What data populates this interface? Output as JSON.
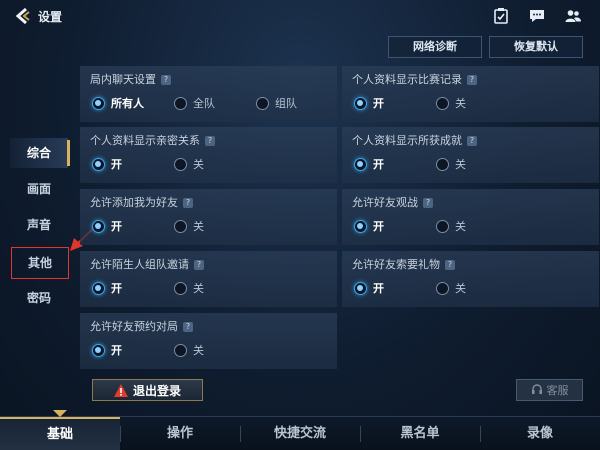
{
  "header": {
    "title": "设置",
    "buttons": {
      "network": "网络诊断",
      "restore": "恢复默认"
    }
  },
  "sidebar": {
    "items": [
      {
        "label": "综合",
        "active": true
      },
      {
        "label": "画面"
      },
      {
        "label": "声音"
      },
      {
        "label": "其他",
        "highlighted": true
      },
      {
        "label": "密码"
      }
    ]
  },
  "panels": {
    "chat": {
      "title": "局内聊天设置",
      "options": [
        "所有人",
        "全队",
        "组队"
      ],
      "selected": "所有人"
    },
    "stats": {
      "title": "个人资料显示比赛记录",
      "options": [
        "开",
        "关"
      ],
      "selected": "开"
    },
    "intimacy": {
      "title": "个人资料显示亲密关系",
      "options": [
        "开",
        "关"
      ],
      "selected": "开"
    },
    "achievements": {
      "title": "个人资料显示所获成就",
      "options": [
        "开",
        "关"
      ],
      "selected": "开"
    },
    "addfriend": {
      "title": "允许添加我为好友",
      "options": [
        "开",
        "关"
      ],
      "selected": "开"
    },
    "spectate": {
      "title": "允许好友观战",
      "options": [
        "开",
        "关"
      ],
      "selected": "开"
    },
    "stranger": {
      "title": "允许陌生人组队邀请",
      "options": [
        "开",
        "关"
      ],
      "selected": "开"
    },
    "gifts": {
      "title": "允许好友索要礼物",
      "options": [
        "开",
        "关"
      ],
      "selected": "开"
    },
    "booking": {
      "title": "允许好友预约对局",
      "options": [
        "开",
        "关"
      ],
      "selected": "开"
    }
  },
  "footer": {
    "logout": "退出登录",
    "service": "客服"
  },
  "bottom_tabs": [
    {
      "label": "基础",
      "active": true
    },
    {
      "label": "操作"
    },
    {
      "label": "快捷交流"
    },
    {
      "label": "黑名单"
    },
    {
      "label": "录像"
    }
  ],
  "colors": {
    "accent_gold": "#d8b35d",
    "radio_on": "#3aa6e8",
    "highlight_box": "#e0362b"
  }
}
